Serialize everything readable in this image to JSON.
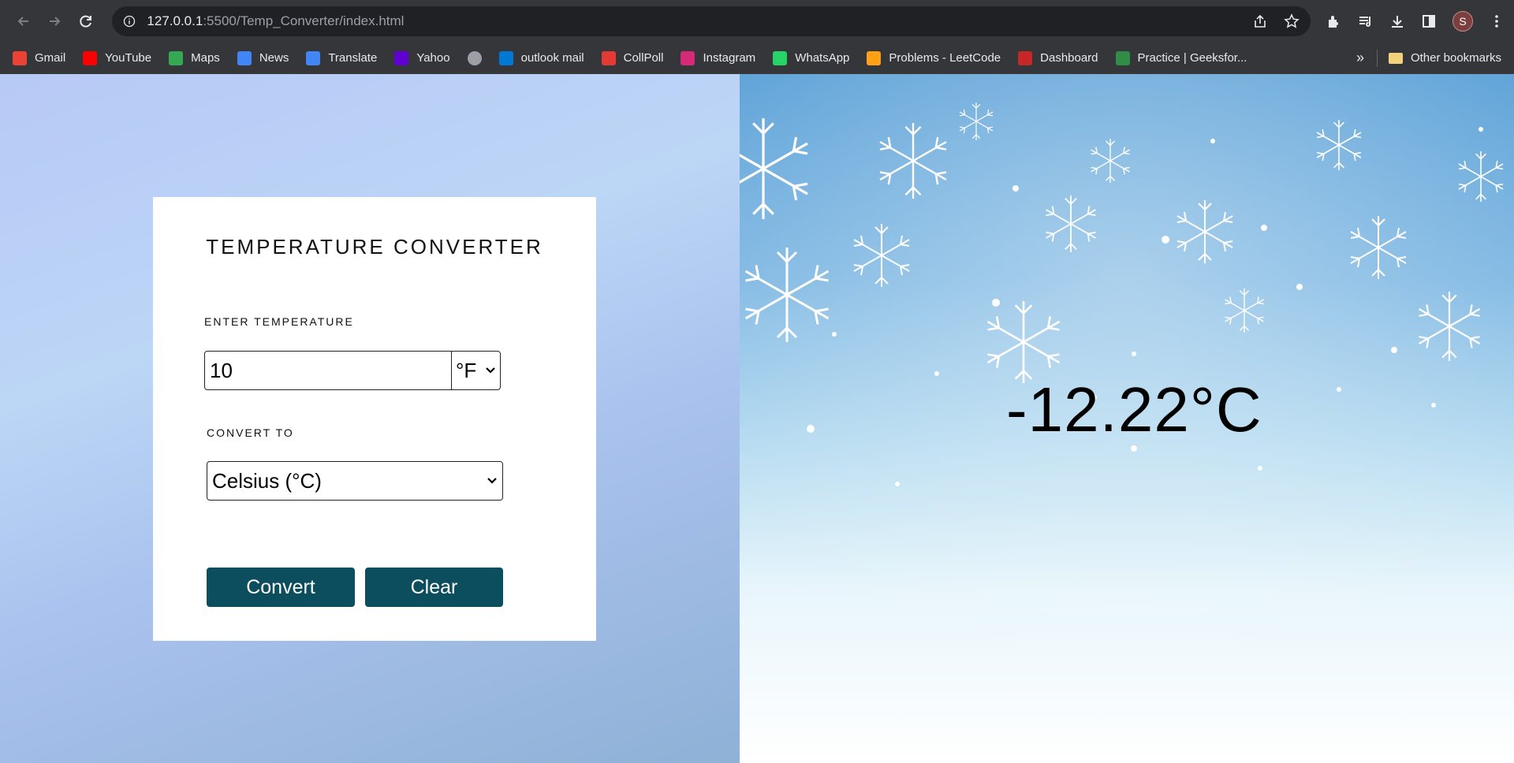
{
  "browser": {
    "url_host": "127.0.0.1",
    "url_rest": ":5500/Temp_Converter/index.html",
    "avatar_letter": "S",
    "bookmarks": [
      {
        "label": "Gmail",
        "icon": "gmail-icon",
        "color": "#ea4335"
      },
      {
        "label": "YouTube",
        "icon": "youtube-icon",
        "color": "#ff0000"
      },
      {
        "label": "Maps",
        "icon": "maps-icon",
        "color": "#34a853"
      },
      {
        "label": "News",
        "icon": "news-icon",
        "color": "#4285f4"
      },
      {
        "label": "Translate",
        "icon": "translate-icon",
        "color": "#4285f4"
      },
      {
        "label": "Yahoo",
        "icon": "yahoo-icon",
        "color": "#6001d2"
      },
      {
        "label": "",
        "icon": "globe-icon",
        "color": "#9aa0a6"
      },
      {
        "label": "outlook mail",
        "icon": "outlook-icon",
        "color": "#0078d4"
      },
      {
        "label": "CollPoll",
        "icon": "collpoll-icon",
        "color": "#e53935"
      },
      {
        "label": "Instagram",
        "icon": "instagram-icon",
        "color": "#d62976"
      },
      {
        "label": "WhatsApp",
        "icon": "whatsapp-icon",
        "color": "#25d366"
      },
      {
        "label": "Problems - LeetCode",
        "icon": "leetcode-icon",
        "color": "#ffa116"
      },
      {
        "label": "Dashboard",
        "icon": "dashboard-icon",
        "color": "#c62828"
      },
      {
        "label": "Practice | Geeksfor...",
        "icon": "geeksforgeeks-icon",
        "color": "#2f8d46"
      }
    ],
    "more_label": "»",
    "other_bookmarks": "Other bookmarks"
  },
  "converter": {
    "title": "TEMPERATURE CONVERTER",
    "enter_label": "ENTER TEMPERATURE",
    "input_value": "10",
    "unit_selected": "°F",
    "convert_to_label": "CONVERT TO",
    "convert_to_selected": "Celsius (°C)",
    "convert_button": "Convert",
    "clear_button": "Clear"
  },
  "result": {
    "value": "-12.22°C"
  }
}
